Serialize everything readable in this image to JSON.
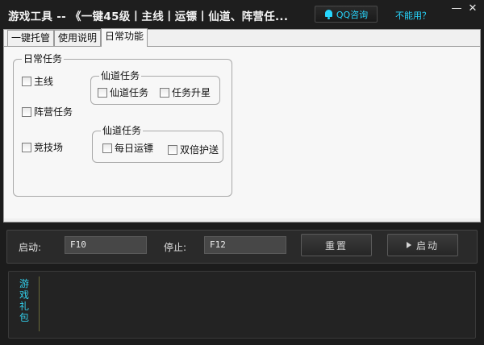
{
  "window": {
    "title": "游戏工具 -- 《一键45级丨主线丨运镖丨仙道、阵营任...",
    "qq_button": "QQ咨询",
    "help_link": "不能用？",
    "min_symbol": "—",
    "close_symbol": "✕"
  },
  "tabs": [
    {
      "label": "一键托管",
      "active": false
    },
    {
      "label": "使用说明",
      "active": false
    },
    {
      "label": "日常功能",
      "active": true
    }
  ],
  "daily_group": {
    "title": "日常任务",
    "items": [
      {
        "label": "主线",
        "checked": false
      },
      {
        "label": "阵营任务",
        "checked": false
      },
      {
        "label": "竞技场",
        "checked": false
      }
    ]
  },
  "xiandao_group_1": {
    "title": "仙道任务",
    "items": [
      {
        "label": "仙道任务",
        "checked": false
      },
      {
        "label": "任务升星",
        "checked": false
      }
    ]
  },
  "xiandao_group_2": {
    "title": "仙道任务",
    "items": [
      {
        "label": "每日运镖",
        "checked": false
      },
      {
        "label": "双倍护送",
        "checked": false
      }
    ]
  },
  "controls": {
    "start_label": "启动:",
    "start_key": "F10",
    "stop_label": "停止:",
    "stop_key": "F12",
    "reset_button": "重置",
    "launch_button": "启动"
  },
  "gift": {
    "label": "游戏礼包"
  },
  "colors": {
    "accent": "#27d7ff",
    "gift_text": "#33d1ee",
    "dark_bg": "#1c1c1c"
  }
}
